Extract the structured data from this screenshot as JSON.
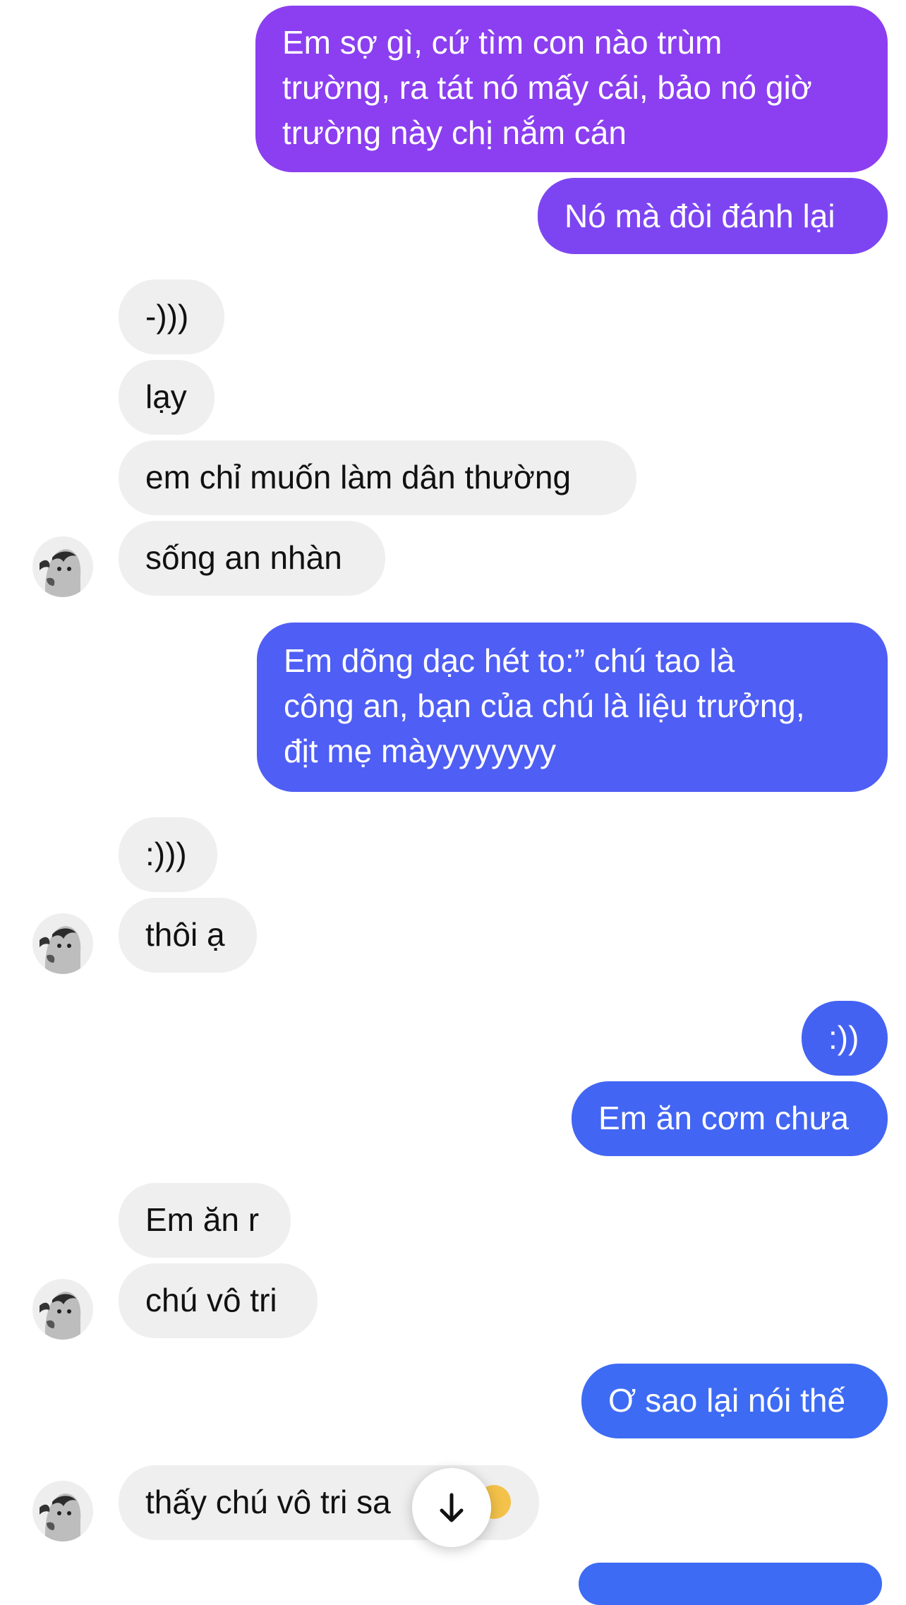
{
  "messages": [
    {
      "id": "m1",
      "side": "out",
      "lines": [
        "Em sợ gì, cứ tìm con nào trùm",
        "trường, ra tát nó mấy cái, bảo nó giờ",
        "trường này chị nắm cán"
      ],
      "color": "#8b3ff0"
    },
    {
      "id": "m2",
      "side": "out",
      "lines": [
        "Nó mà đòi đánh lại"
      ],
      "color": "#7d45f2"
    },
    {
      "id": "m3",
      "side": "in",
      "lines": [
        "-)))"
      ]
    },
    {
      "id": "m4",
      "side": "in",
      "lines": [
        "lạy"
      ]
    },
    {
      "id": "m5",
      "side": "in",
      "lines": [
        "em chỉ muốn làm dân thường"
      ]
    },
    {
      "id": "m6",
      "side": "in",
      "lines": [
        "sống an nhàn"
      ]
    },
    {
      "id": "m7",
      "side": "out",
      "lines": [
        "Em dõng dạc hét to:” chú tao là",
        "công an, bạn của chú là liệu trưởng,",
        "địt mẹ màyyyyyyyy"
      ],
      "color": "#4f5ef4"
    },
    {
      "id": "m8",
      "side": "in",
      "lines": [
        ":)))"
      ]
    },
    {
      "id": "m9",
      "side": "in",
      "lines": [
        "thôi ạ"
      ]
    },
    {
      "id": "m10",
      "side": "out",
      "lines": [
        ":))"
      ],
      "color": "#4462f2"
    },
    {
      "id": "m11",
      "side": "out",
      "lines": [
        "Em ăn cơm chưa"
      ],
      "color": "#4265f3"
    },
    {
      "id": "m12",
      "side": "in",
      "lines": [
        "Em ăn r"
      ]
    },
    {
      "id": "m13",
      "side": "in",
      "lines": [
        "chú vô tri"
      ]
    },
    {
      "id": "m14",
      "side": "out",
      "lines": [
        "Ơ sao lại nói thế"
      ],
      "color": "#3d6bf4"
    },
    {
      "id": "m15",
      "side": "in",
      "lines": [
        "thấy chú vô tri sa"
      ]
    }
  ],
  "icons": {
    "scroll_down": "arrow-down-icon",
    "avatar": "avatar",
    "emoji": "smile-emoji-icon"
  },
  "colors": {
    "incoming_bg": "#efefef",
    "incoming_text": "#111111",
    "outgoing_text": "#ffffff",
    "background": "#ffffff"
  }
}
